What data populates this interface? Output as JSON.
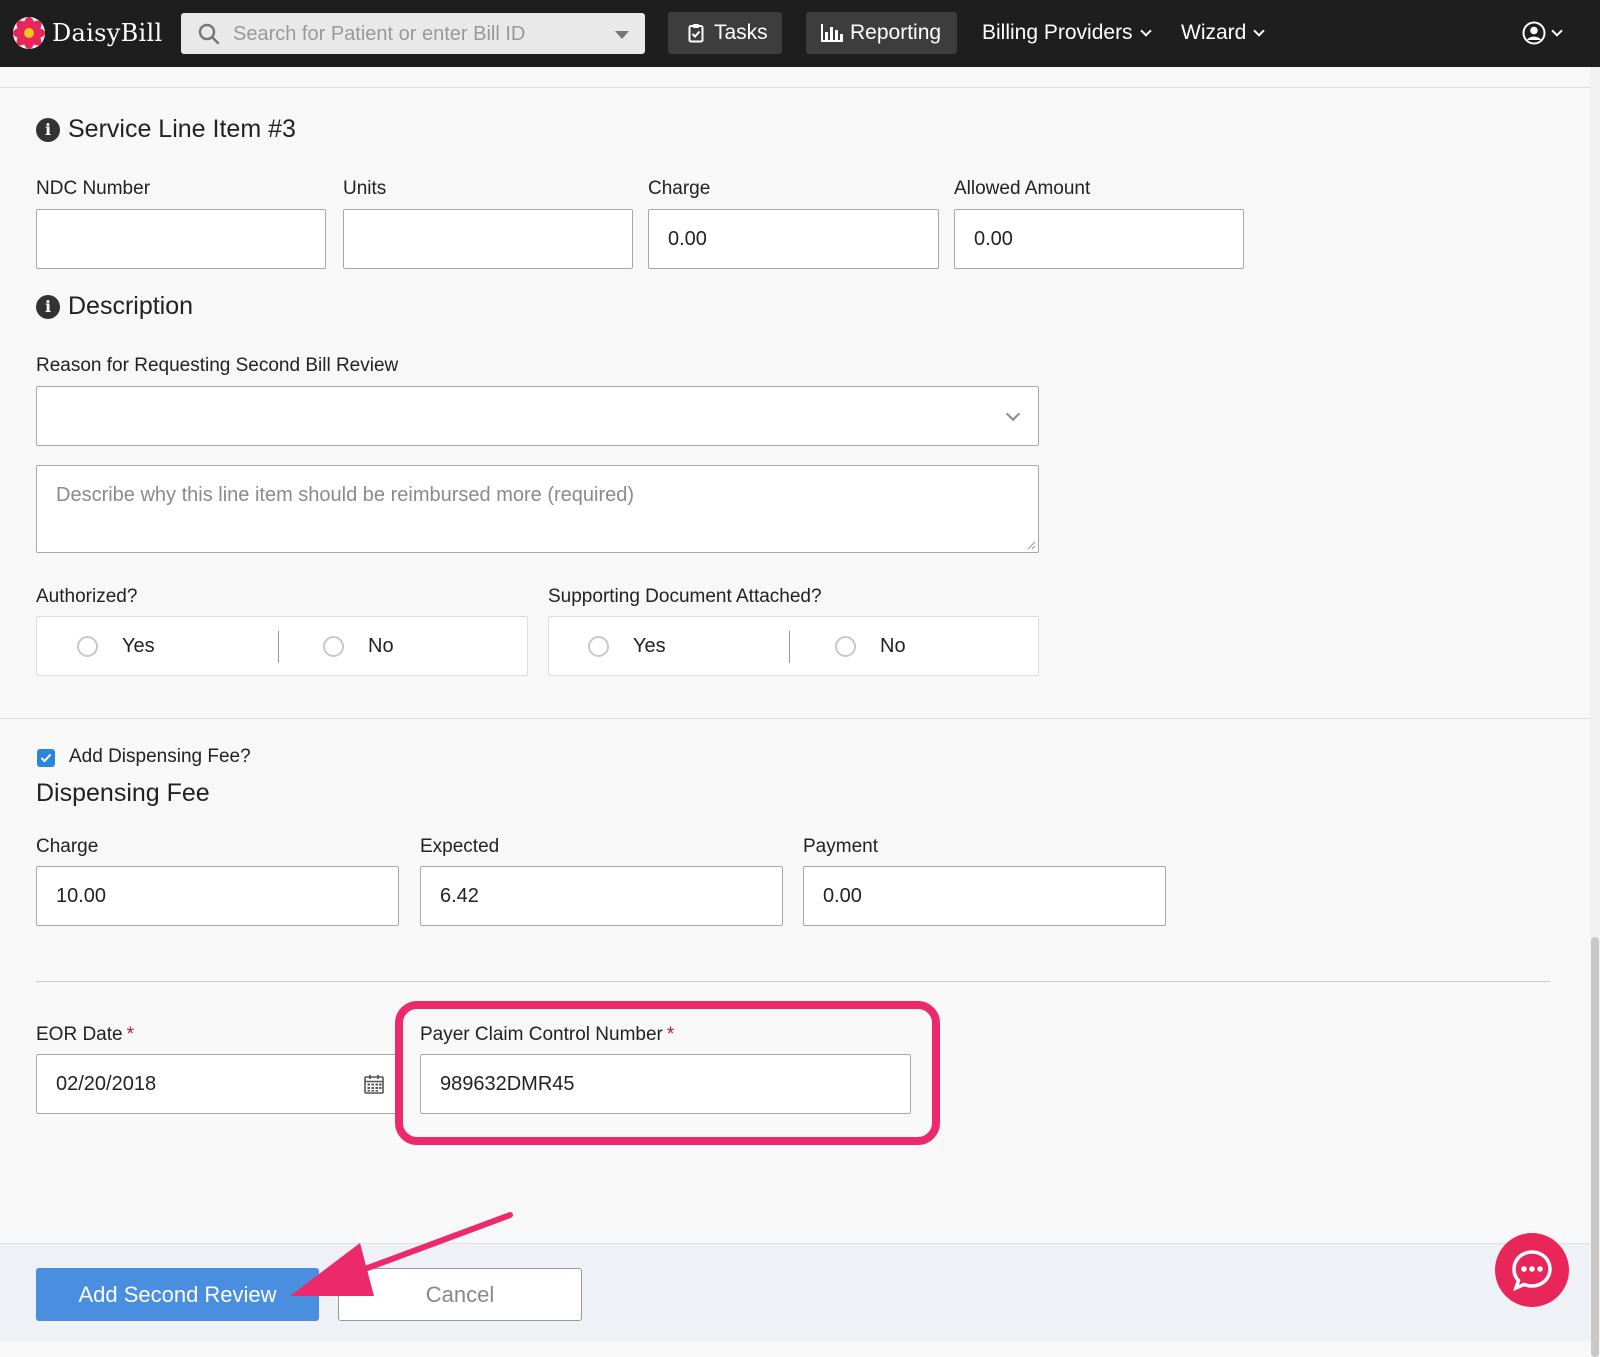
{
  "nav": {
    "brand": "DaisyBill",
    "search_placeholder": "Search for Patient or enter Bill ID",
    "tasks": "Tasks",
    "reporting": "Reporting",
    "billing_providers": "Billing Providers",
    "wizard": "Wizard"
  },
  "service_line": {
    "heading": "Service Line Item #3",
    "ndc_label": "NDC Number",
    "ndc_value": "",
    "units_label": "Units",
    "units_value": "",
    "charge_label": "Charge",
    "charge_value": "0.00",
    "allowed_label": "Allowed Amount",
    "allowed_value": "0.00"
  },
  "description": {
    "heading": "Description",
    "reason_label": "Reason for Requesting Second Bill Review",
    "reason_value": "",
    "textarea_placeholder": "Describe why this line item should be reimbursed more (required)",
    "authorized_label": "Authorized?",
    "supporting_label": "Supporting Document Attached?",
    "yes": "Yes",
    "no": "No"
  },
  "dispensing": {
    "checkbox_label": "Add Dispensing Fee?",
    "checked": true,
    "heading": "Dispensing Fee",
    "charge_label": "Charge",
    "charge_value": "10.00",
    "expected_label": "Expected",
    "expected_value": "6.42",
    "payment_label": "Payment",
    "payment_value": "0.00"
  },
  "eor": {
    "date_label": "EOR Date",
    "date_value": "02/20/2018",
    "pcn_label": "Payer Claim Control Number",
    "pcn_value": "989632DMR45",
    "required_mark": "*"
  },
  "footer": {
    "submit": "Add Second Review",
    "cancel": "Cancel"
  },
  "colors": {
    "highlight": "#ec2a6b",
    "primary": "#4a8ee0",
    "chat": "#e8265a"
  }
}
